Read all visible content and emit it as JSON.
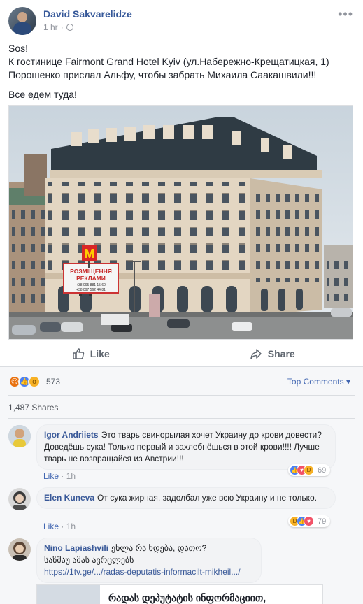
{
  "post": {
    "author": "David Sakvarelidze",
    "time": "1 hr",
    "lines": [
      "Sos!",
      "К гостинице Fairmont Grand Hotel Kyiv (ул.Набережно-Крещатицкая, 1)",
      "Порошенко прислал Альфу, чтобы забрать Михаила Саакашвили!!!",
      "Все едем туда!"
    ],
    "billboard": {
      "title": "РОЗМІЩЕННЯ",
      "subtitle": "РЕКЛАМИ",
      "phone1": "+38 095 881 15 60",
      "phone2": "+38 097 562 44 81"
    }
  },
  "actions": {
    "like": "Like",
    "share": "Share"
  },
  "stats": {
    "reaction_count": "573",
    "top_comments": "Top Comments",
    "shares": "1,487 Shares"
  },
  "comments": [
    {
      "name": "Igor Andriiets",
      "text": "Это тварь свинорылая хочет Украину до крови довести? Доведёшь сука! Только первый и захлебнёшься в этой крови!!!! Лучше тварь не возвращайся из Австрии!!!",
      "like": "Like",
      "time": "1h",
      "reactions": "69"
    },
    {
      "name": "Elen Kuneva",
      "text": "От сука жирная, задолбал уже всю Украину и не только.",
      "like": "Like",
      "time": "1h",
      "reactions": "79"
    },
    {
      "name": "Nino Lapiashvili",
      "line1": "ეხლა რა ხდება, დათო?",
      "line2": "საზმაუ ამას ავრცლებს",
      "link": "https://1tv.ge/.../radas-deputatis-informacilt-mikheil.../",
      "card_title": "რადას დეპუტატის ინფორმაციით,"
    }
  ],
  "colors": {
    "link": "#365899",
    "accent": "#4267b2",
    "muted": "#90949c"
  }
}
